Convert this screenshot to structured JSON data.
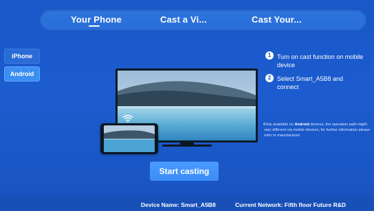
{
  "tabs": [
    {
      "label": "Your Phone"
    },
    {
      "label": "Cast a Vi..."
    },
    {
      "label": "Cast Your..."
    }
  ],
  "options": {
    "iphone": "iPhone",
    "android": "Android",
    "selected": "Android"
  },
  "steps": [
    {
      "num": "1",
      "text": "Turn on cast function on mobile device"
    },
    {
      "num": "2",
      "text": "Select Smart_A5B8 and connect"
    }
  ],
  "note": {
    "prefix": "Only available on ",
    "bold": "Android",
    "suffix": " devices, the operation path might vary different via mobile devices, for further information please refer to manufacturer."
  },
  "start_button": "Start casting",
  "footer": {
    "device_name": "Device Name: Smart_A5B8",
    "network": "Current Network: Fifth floor Future R&D"
  },
  "colors": {
    "background": "#1a57c8",
    "tabbar": "#2d74de",
    "button": "#4a9bff"
  },
  "icons": [
    "wifi-icon"
  ]
}
